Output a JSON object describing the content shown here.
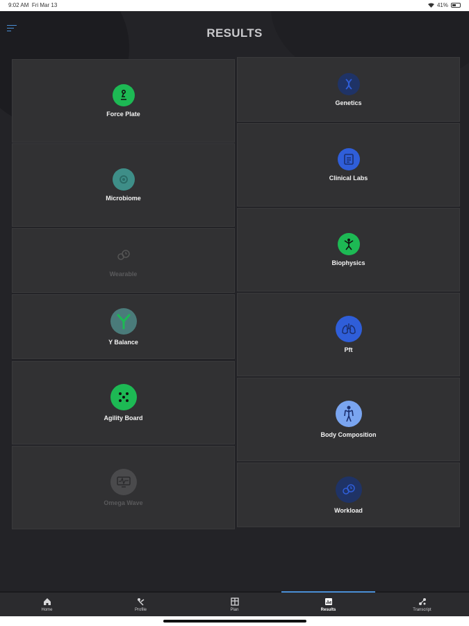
{
  "status_bar": {
    "time": "9:02 AM",
    "date": "Fri Mar 13",
    "battery": "41%"
  },
  "header": {
    "title": "RESULTS",
    "menu_icon": "menu-icon"
  },
  "colors": {
    "green": "#1db954",
    "blue": "#2f5ed9",
    "navy": "#1f3366",
    "teal": "#3e8e88",
    "light_blue": "#7aa5f0",
    "gray": "#5a5a5c",
    "accent": "#4a8fd6"
  },
  "left_cards": [
    {
      "label": "Force Plate",
      "icon": "force-plate-icon",
      "enabled": true
    },
    {
      "label": "Microbiome",
      "icon": "microbiome-icon",
      "enabled": true
    },
    {
      "label": "Wearable",
      "icon": "wearable-icon",
      "enabled": false
    },
    {
      "label": "Y Balance",
      "icon": "y-balance-icon",
      "enabled": true
    },
    {
      "label": "Agility Board",
      "icon": "agility-board-icon",
      "enabled": true
    },
    {
      "label": "Omega Wave",
      "icon": "omega-wave-icon",
      "enabled": false
    }
  ],
  "right_cards": [
    {
      "label": "Genetics",
      "icon": "genetics-icon",
      "enabled": true
    },
    {
      "label": "Clinical Labs",
      "icon": "clinical-labs-icon",
      "enabled": true
    },
    {
      "label": "Biophysics",
      "icon": "biophysics-icon",
      "enabled": true
    },
    {
      "label": "Pft",
      "icon": "lungs-icon",
      "enabled": true
    },
    {
      "label": "Body Composition",
      "icon": "body-composition-icon",
      "enabled": true
    },
    {
      "label": "Workload",
      "icon": "workload-icon",
      "enabled": true
    }
  ],
  "bottom_nav": [
    {
      "label": "Home",
      "icon": "home-icon",
      "active": false
    },
    {
      "label": "Profile",
      "icon": "profile-icon",
      "active": false
    },
    {
      "label": "Plan",
      "icon": "plan-icon",
      "active": false
    },
    {
      "label": "Results",
      "icon": "results-icon",
      "active": true
    },
    {
      "label": "Transcript",
      "icon": "transcript-icon",
      "active": false
    }
  ]
}
